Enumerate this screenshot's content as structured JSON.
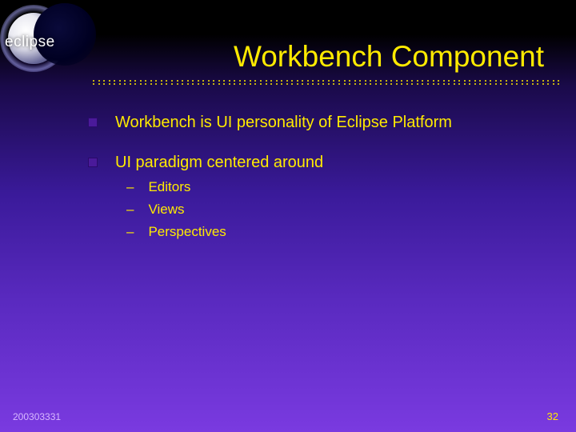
{
  "logo": {
    "text": "eclipse"
  },
  "title": "Workbench Component",
  "bullets": [
    {
      "text": "Workbench is UI personality of Eclipse Platform",
      "sub": []
    },
    {
      "text": "UI paradigm centered around",
      "sub": [
        "Editors",
        "Views",
        "Perspectives"
      ]
    }
  ],
  "footer": {
    "left": "200303331",
    "right": "32"
  }
}
